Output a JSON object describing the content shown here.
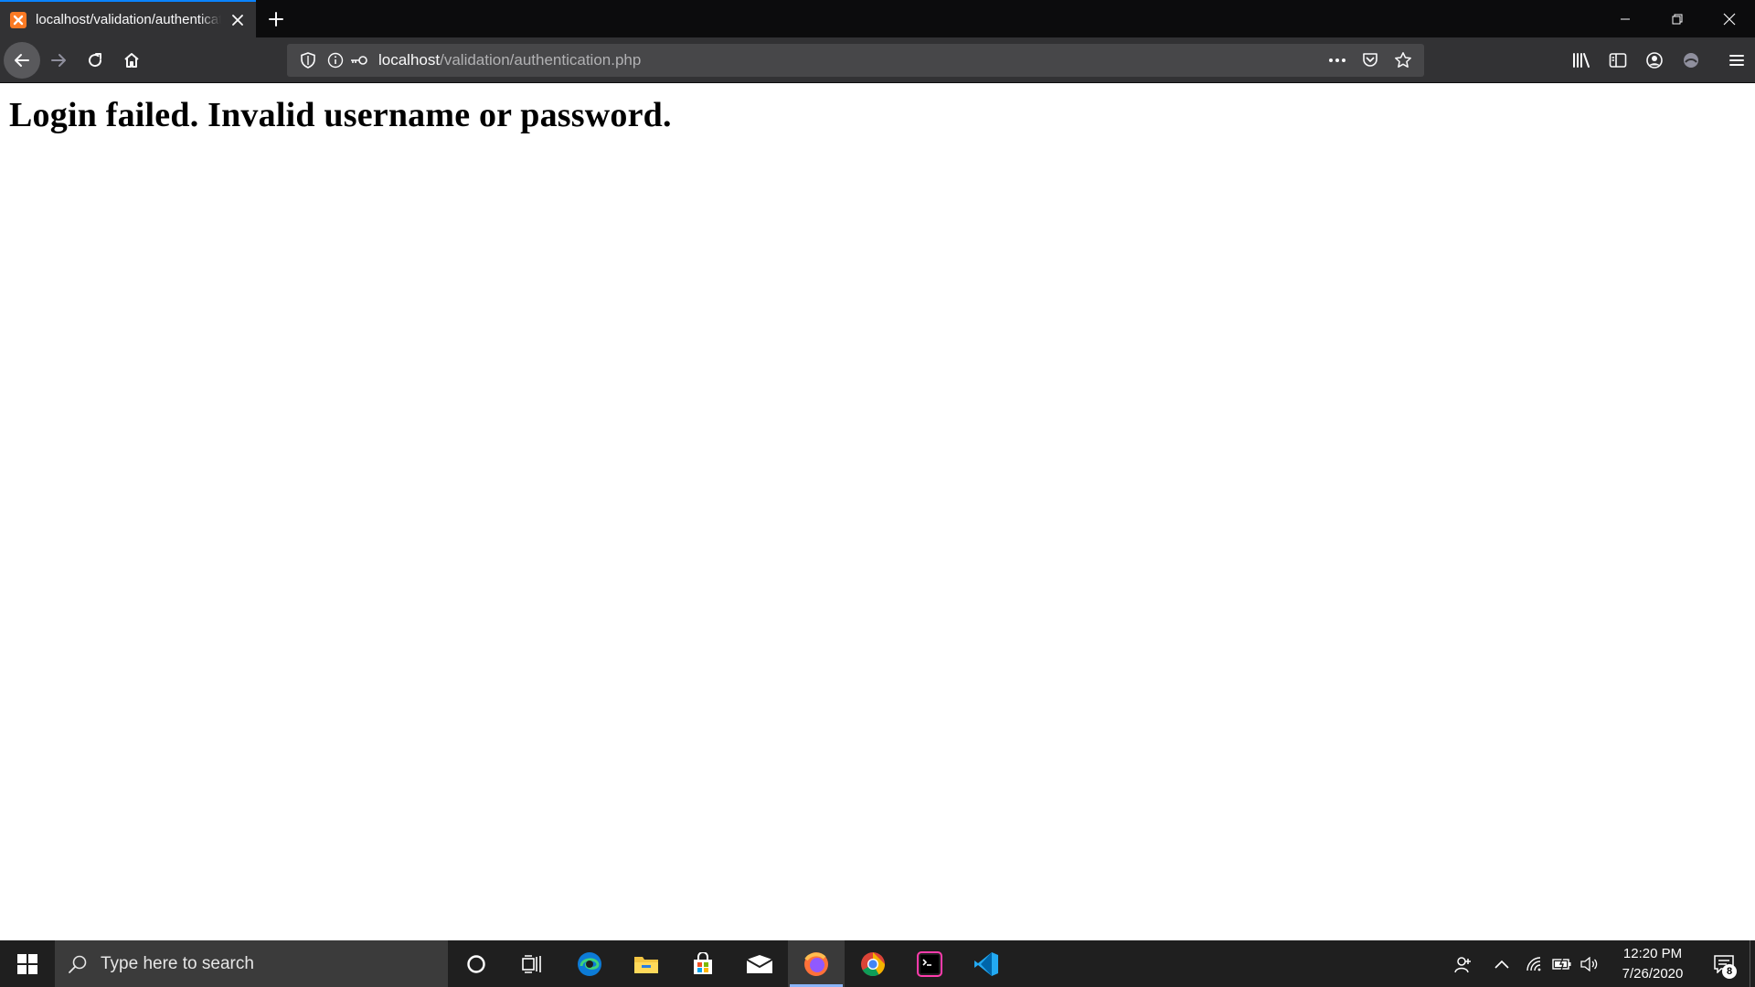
{
  "browser": {
    "tab": {
      "title": "localhost/validation/authentication.php",
      "favicon_letter": "⌘"
    },
    "url": {
      "host": "localhost",
      "path": "/validation/authentication.php"
    },
    "accent_color": "#0a84ff"
  },
  "page": {
    "heading": "Login failed. Invalid username or password."
  },
  "taskbar": {
    "search_placeholder": "Type here to search",
    "clock": {
      "time": "12:20 PM",
      "date": "7/26/2020"
    },
    "notification_count": "8",
    "apps": [
      "cortana-icon",
      "task-view-icon",
      "edge-icon",
      "file-explorer-icon",
      "store-icon",
      "mail-icon",
      "firefox-icon",
      "chrome-icon",
      "terminal-icon",
      "vscode-icon"
    ]
  }
}
